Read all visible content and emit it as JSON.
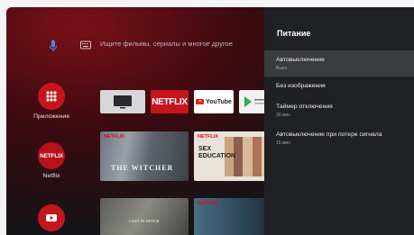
{
  "search": {
    "placeholder": "Ищите фильмы, сериалы и многое другое"
  },
  "apps": [
    {
      "label": "Приложения",
      "icon": "apps-grid-icon"
    },
    {
      "label": "Netflix",
      "icon_text": "NETFLIX"
    },
    {
      "label": "",
      "icon": "youtube-icon"
    }
  ],
  "app_row": {
    "netflix": "NETFLIX",
    "youtube": "YouTube"
  },
  "posters": {
    "witcher": {
      "badge": "NETFLIX",
      "title": "THE WITCHER"
    },
    "sex_education": {
      "badge": "NETFLIX",
      "title_line1": "SEX",
      "title_line2": "EDUCATION"
    },
    "row2b": {
      "badge": "NETFLIX"
    },
    "row2a": {
      "title": "LOST IN SPACE"
    }
  },
  "panel": {
    "title": "Питание",
    "items": [
      {
        "label": "Автовыключение",
        "sub": "Выкл.",
        "selected": true
      },
      {
        "label": "Без изображения",
        "sub": ""
      },
      {
        "label": "Таймер отключения",
        "sub": "30 мин."
      },
      {
        "label": "Автовыключение при потере сигнала",
        "sub": "15 мин."
      }
    ]
  },
  "colors": {
    "accent": "#c4161c",
    "panel_bg": "#202124",
    "selected_bg": "#3a3b3f"
  }
}
